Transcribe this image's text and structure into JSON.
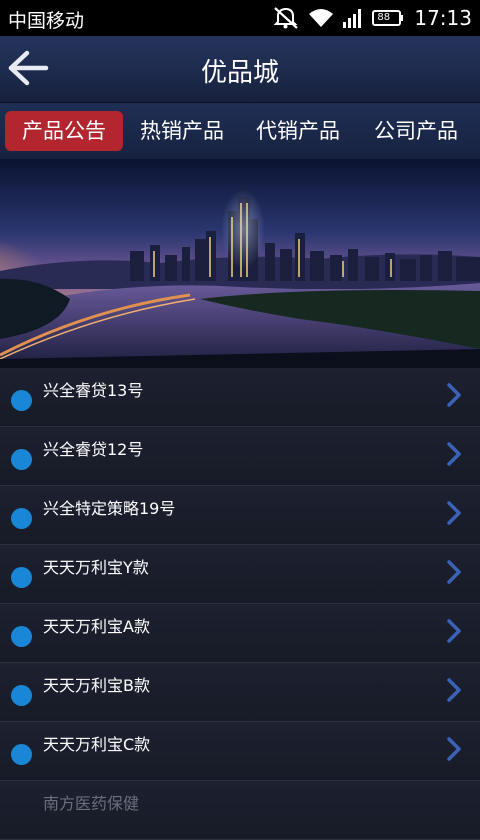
{
  "status": {
    "carrier": "中国移动",
    "time": "17:13",
    "battery_label": "88"
  },
  "header": {
    "title": "优品城"
  },
  "tabs": [
    {
      "label": "产品公告",
      "active": true
    },
    {
      "label": "热销产品",
      "active": false
    },
    {
      "label": "代销产品",
      "active": false
    },
    {
      "label": "公司产品",
      "active": false
    }
  ],
  "products": [
    {
      "label": "兴全睿贷13号"
    },
    {
      "label": "兴全睿贷12号"
    },
    {
      "label": "兴全特定策略19号"
    },
    {
      "label": "天天万利宝Y款"
    },
    {
      "label": "天天万利宝A款"
    },
    {
      "label": "天天万利宝B款"
    },
    {
      "label": "天天万利宝C款"
    },
    {
      "label": "南方医药保健"
    }
  ],
  "colors": {
    "active_tab": "#b3262f",
    "bullet": "#1a86d6",
    "chevron": "#3a63b8"
  },
  "icons": [
    "mute-icon",
    "wifi-icon",
    "signal-icon",
    "battery-icon",
    "back-arrow-icon",
    "chevron-right-icon"
  ]
}
